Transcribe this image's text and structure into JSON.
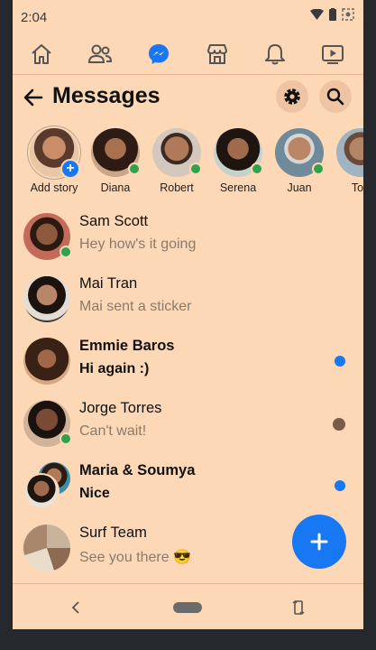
{
  "status": {
    "time": "2:04"
  },
  "nav": {
    "tabs": [
      {
        "icon": "home-icon"
      },
      {
        "icon": "friends-icon"
      },
      {
        "icon": "messenger-icon",
        "active": true
      },
      {
        "icon": "marketplace-icon"
      },
      {
        "icon": "bell-icon"
      },
      {
        "icon": "watch-video-icon"
      }
    ]
  },
  "header": {
    "title": "Messages"
  },
  "stories": [
    {
      "name": "Add story",
      "add": true
    },
    {
      "name": "Diana",
      "online": true
    },
    {
      "name": "Robert",
      "online": true
    },
    {
      "name": "Serena",
      "online": true
    },
    {
      "name": "Juan",
      "online": true
    },
    {
      "name": "Ton"
    }
  ],
  "conversations": [
    {
      "name": "Sam Scott",
      "message": "Hey how's it going",
      "online": true
    },
    {
      "name": "Mai Tran",
      "message": "Mai sent a sticker"
    },
    {
      "name": "Emmie Baros",
      "message": "Hi again :)",
      "unread": true
    },
    {
      "name": "Jorge Torres",
      "message": "Can't wait!",
      "online": true,
      "seen": true
    },
    {
      "name": "Maria & Soumya",
      "message": "Nice",
      "unread": true,
      "group": true
    },
    {
      "name": "Surf Team",
      "message": "See you there 😎",
      "group": true
    }
  ],
  "colors": {
    "background": "#fdd8b6",
    "accent": "#1877f2",
    "online": "#31a24c"
  }
}
